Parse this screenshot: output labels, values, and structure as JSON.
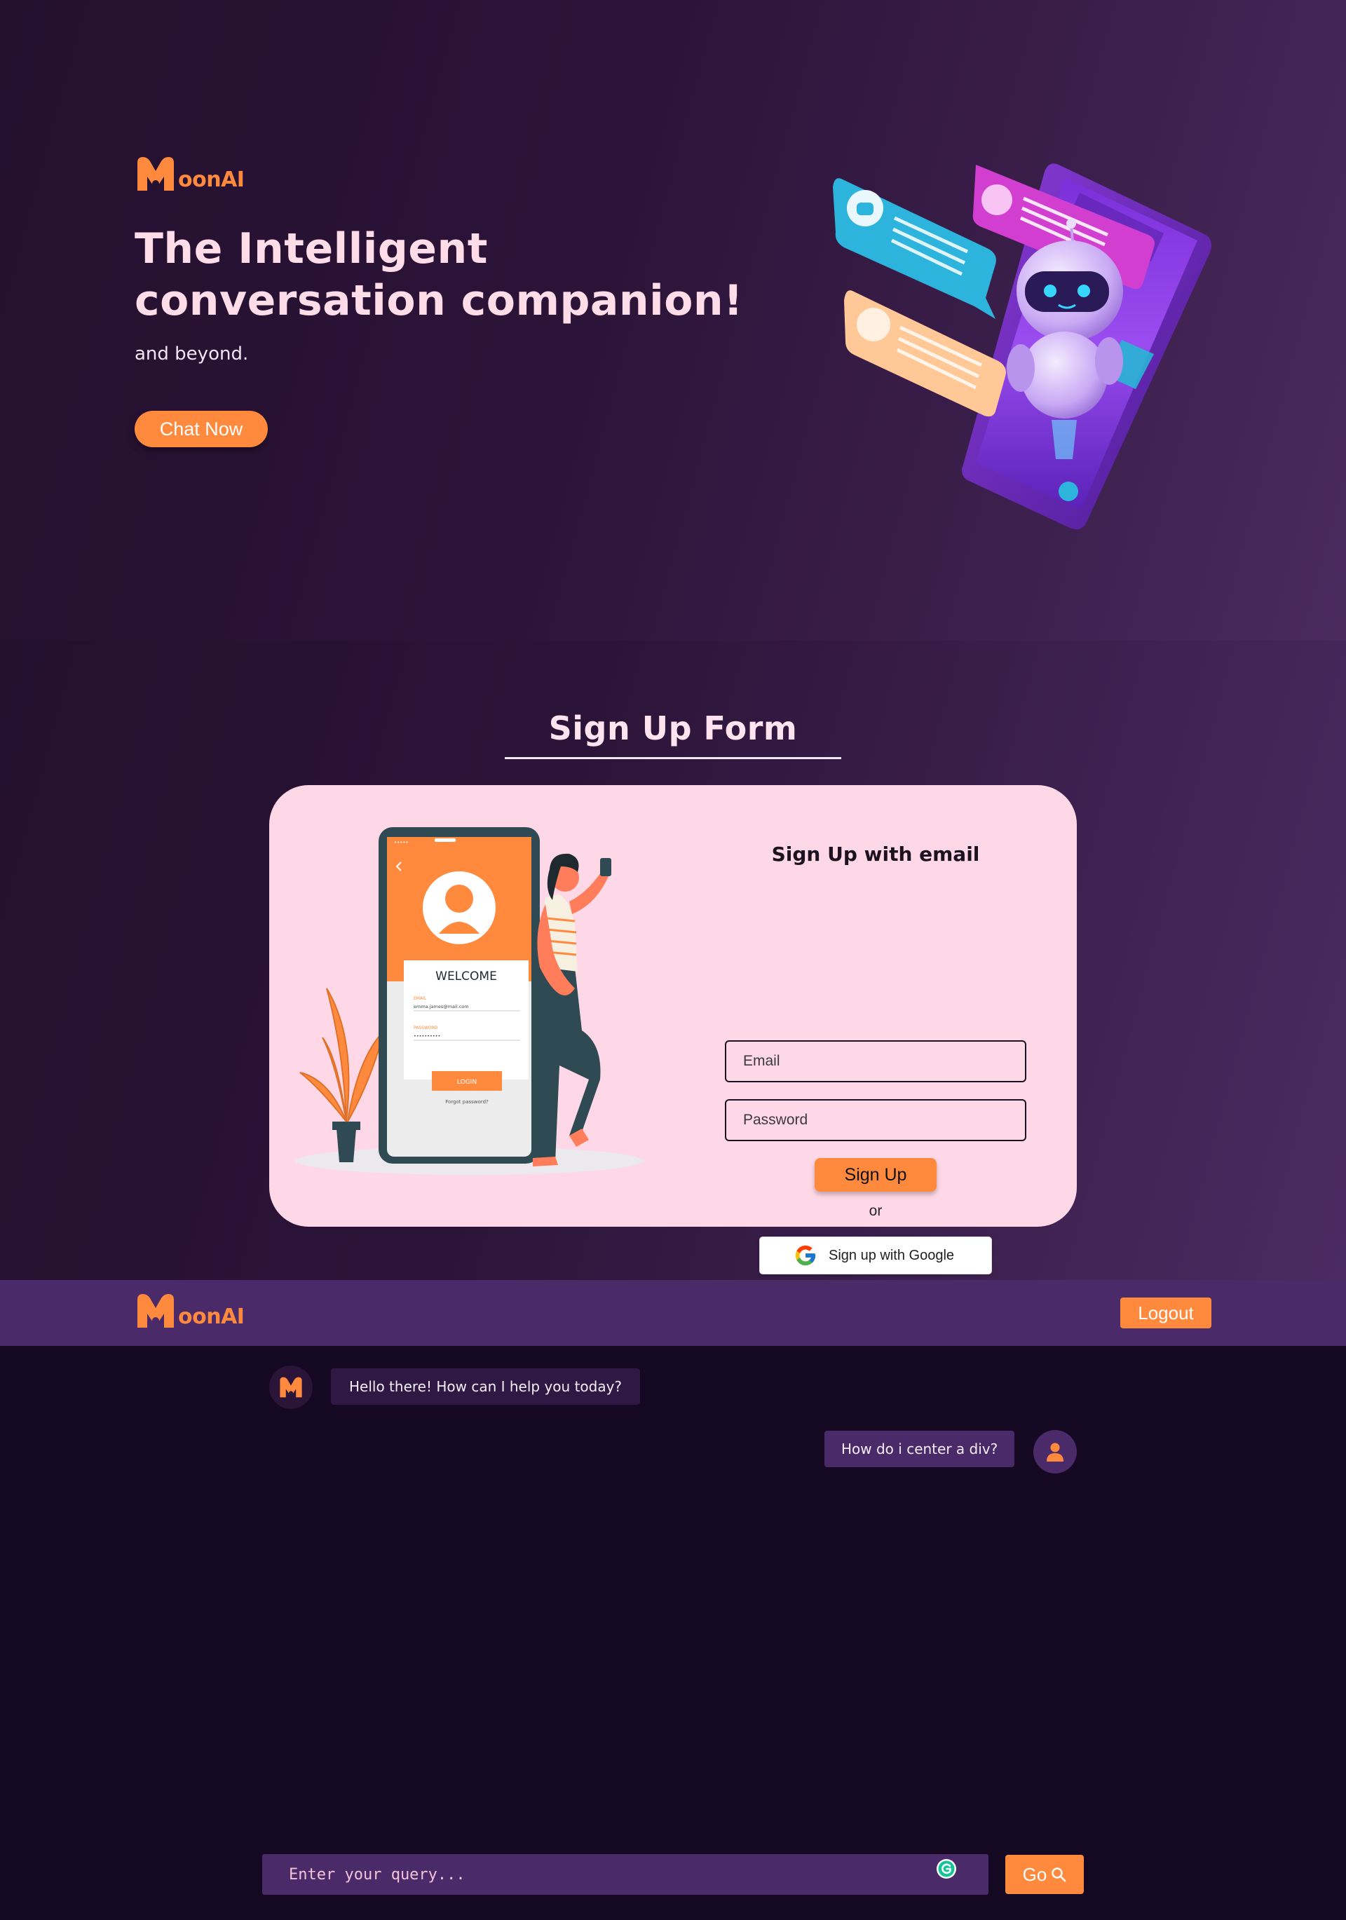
{
  "brand": {
    "logo_text": "oonAI",
    "accent_color": "#ff8a3d"
  },
  "hero": {
    "title_line1": "The Intelligent",
    "title_line2": "conversation companion!",
    "subtitle": "and beyond.",
    "cta_label": "Chat Now"
  },
  "signup": {
    "section_title": "Sign Up Form",
    "form_title": "Sign Up with email",
    "email_placeholder": "Email",
    "password_placeholder": "Password",
    "submit_label": "Sign Up",
    "or_text": "or",
    "google_label": "Sign up with Google",
    "illustration": {
      "welcome": "WELCOME",
      "email_label": "EMAIL",
      "email_value": "emma.james@mail.com",
      "password_label": "PASSWORD",
      "password_value": "••••••••••",
      "login_label": "LOGIN",
      "forgot_label": "Forgot password?"
    }
  },
  "chat": {
    "logout_label": "Logout",
    "messages": [
      {
        "role": "bot",
        "text": "Hello there! How can I help you today?"
      },
      {
        "role": "user",
        "text": "How do i center a div?"
      }
    ],
    "input_placeholder": "Enter your query...",
    "go_label": "Go"
  },
  "icons": {
    "logo": "moon-m-logo-icon",
    "google": "google-g-icon",
    "user": "user-icon",
    "search": "search-icon",
    "grammarly": "grammarly-icon"
  }
}
